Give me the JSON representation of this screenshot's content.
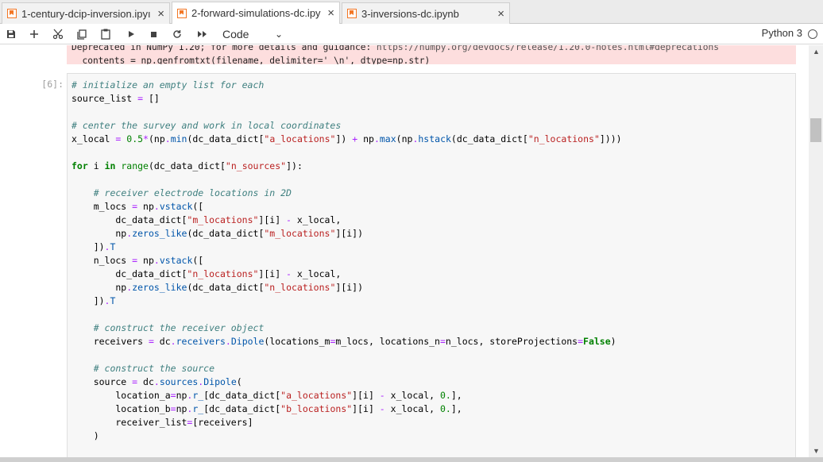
{
  "tabs": [
    {
      "label": "1-century-dcip-inversion.ipyı",
      "close": "×"
    },
    {
      "label": "2-forward-simulations-dc.ipy",
      "close": "×"
    },
    {
      "label": "3-inversions-dc.ipynb",
      "close": "×"
    }
  ],
  "toolbar": {
    "cell_type": "Code",
    "cell_type_chevron": "⌄",
    "kernel_name": "Python 3",
    "icons": [
      "save-icon",
      "add-cell-icon",
      "cut-icon",
      "copy-icon",
      "paste-icon",
      "run-icon",
      "stop-icon",
      "restart-icon",
      "run-all-icon"
    ]
  },
  "output_warning": {
    "line1": "Deprecated in NumPy 1.20; for more details and guidance: ",
    "line1_url": "https://numpy.org/devdocs/release/1.20.0-notes.html#deprecations",
    "line2": "  contents = np.genfromtxt(filename, delimiter=' \\n', dtype=np.str)"
  },
  "cell": {
    "prompt": "[6]:"
  },
  "colors": {
    "warning_bg": "#fddede",
    "notebook_icon": "#f37726",
    "comment": "#408080",
    "string": "#ba2121",
    "keyword": "#008000"
  }
}
